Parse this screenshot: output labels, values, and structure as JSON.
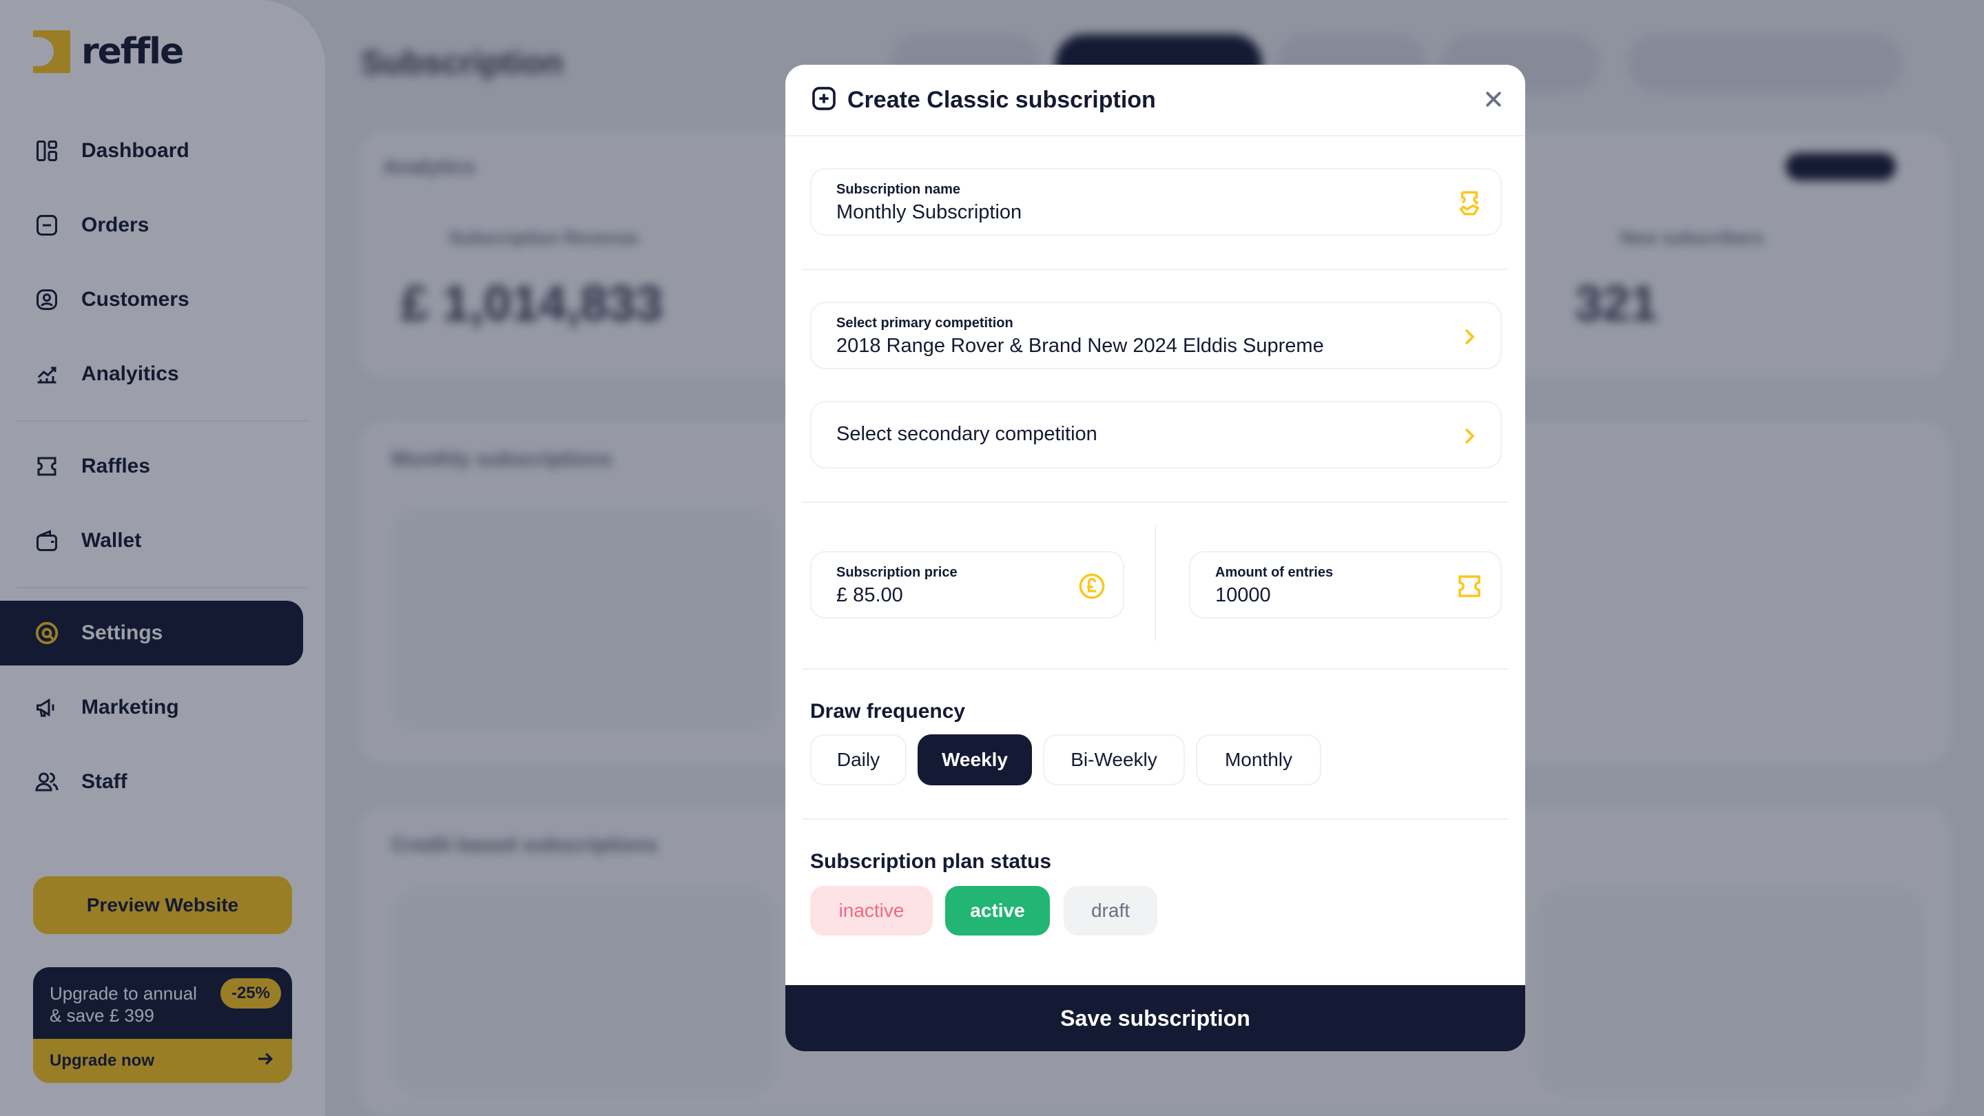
{
  "brand": {
    "name": "reffle",
    "accent": "#fbc71e",
    "navy": "#141a33"
  },
  "sidebar": {
    "items": [
      {
        "label": "Dashboard",
        "icon": "dashboard-icon"
      },
      {
        "label": "Orders",
        "icon": "orders-icon"
      },
      {
        "label": "Customers",
        "icon": "customers-icon"
      },
      {
        "label": "Analyitics",
        "icon": "analytics-icon"
      },
      {
        "label": "Raffles",
        "icon": "ticket-icon"
      },
      {
        "label": "Wallet",
        "icon": "wallet-icon"
      },
      {
        "label": "Settings",
        "icon": "settings-icon",
        "active": true
      },
      {
        "label": "Marketing",
        "icon": "megaphone-icon"
      },
      {
        "label": "Staff",
        "icon": "staff-icon"
      }
    ],
    "preview_label": "Preview Website",
    "upgrade": {
      "line1": "Upgrade to annual",
      "line2": "& save £ 399",
      "badge": "-25%",
      "cta": "Upgrade now"
    }
  },
  "background": {
    "title": "Subscription",
    "analytics_label": "Analytics",
    "revenue_value": "£ 1,014,833",
    "revenue_label": "Subscription Revenue",
    "subscribers_value": "321",
    "subscribers_label": "New subscribers",
    "monthly_label": "Monthly subscriptions",
    "credit_label": "Credit based subscriptions"
  },
  "modal": {
    "title": "Create Classic subscription",
    "subscription_name": {
      "label": "Subscription name",
      "value": "Monthly Subscription"
    },
    "primary_competition": {
      "label": "Select primary competition",
      "value": "2018 Range Rover & Brand New 2024 Elddis Supreme"
    },
    "secondary_competition": {
      "placeholder": "Select secondary competition"
    },
    "price": {
      "label": "Subscription price",
      "value": "£ 85.00"
    },
    "entries": {
      "label": "Amount of entries",
      "value": "10000"
    },
    "draw_frequency": {
      "title": "Draw frequency",
      "options": [
        "Daily",
        "Weekly",
        "Bi-Weekly",
        "Monthly"
      ],
      "selected": "Weekly"
    },
    "status": {
      "title": "Subscription plan status",
      "options": [
        "inactive",
        "active",
        "draft"
      ],
      "selected": "active",
      "colors": {
        "inactive": "#ef6a7e",
        "active": "#22b573",
        "draft": "#6b7083"
      }
    },
    "save_label": "Save subscription"
  }
}
